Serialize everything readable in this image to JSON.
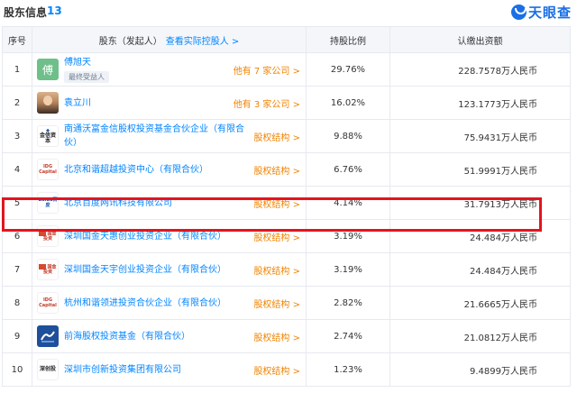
{
  "header": {
    "title": "股东信息",
    "count": "13",
    "brand": "天眼查"
  },
  "table": {
    "columns": {
      "index": "序号",
      "holder": "股东（发起人）",
      "holder_link": "查看实际控股人 >",
      "ratio": "持股比例",
      "amount": "认缴出资额"
    },
    "rows": [
      {
        "index": "1",
        "name": "傅旭天",
        "badge": "最终受益人",
        "logo_char": "傅",
        "right_prefix": "他有 ",
        "right_num": "7",
        "right_suffix": " 家公司 >",
        "ratio": "29.76%",
        "amount": "228.7578万人民币"
      },
      {
        "index": "2",
        "name": "袁立川",
        "right_prefix": "他有 ",
        "right_num": "3",
        "right_suffix": " 家公司 >",
        "ratio": "16.02%",
        "amount": "123.1773万人民币"
      },
      {
        "index": "3",
        "name": "南通沃富金信股权投资基金合伙企业（有限合伙）",
        "logo_text": "金信资本",
        "right": "股权结构 >",
        "ratio": "9.88%",
        "amount": "75.9431万人民币"
      },
      {
        "index": "4",
        "name": "北京和谐超越投资中心（有限合伙）",
        "logo_text": "IDG Capital",
        "right": "股权结构 >",
        "ratio": "6.76%",
        "amount": "51.9991万人民币"
      },
      {
        "index": "5",
        "name": "北京百度网讯科技有限公司",
        "logo_text": "Baidu百度",
        "right": "股权结构 >",
        "ratio": "4.14%",
        "amount": "31.7913万人民币"
      },
      {
        "index": "6",
        "name": "深圳国金天惠创业投资企业（有限合伙）",
        "logo_text": "国金投资",
        "right": "股权结构 >",
        "ratio": "3.19%",
        "amount": "24.484万人民币"
      },
      {
        "index": "7",
        "name": "深圳国金天宇创业投资企业（有限合伙）",
        "logo_text": "国金投资",
        "right": "股权结构 >",
        "ratio": "3.19%",
        "amount": "24.484万人民币"
      },
      {
        "index": "8",
        "name": "杭州和谐领进投资合伙企业（有限合伙）",
        "logo_text": "IDG Capital",
        "right": "股权结构 >",
        "ratio": "2.82%",
        "amount": "21.6665万人民币"
      },
      {
        "index": "9",
        "name": "前海股权投资基金（有限合伙）",
        "right": "股权结构 >",
        "ratio": "2.74%",
        "amount": "21.0812万人民币"
      },
      {
        "index": "10",
        "name": "深圳市创新投资集团有限公司",
        "logo_text": "深创投",
        "right": "股权结构 >",
        "ratio": "1.23%",
        "amount": "9.4899万人民币"
      }
    ]
  },
  "colors": {
    "link": "#0084ff",
    "accent_orange": "#f08300",
    "highlight": "#e3141f",
    "header_bg": "#f4f6fa"
  }
}
